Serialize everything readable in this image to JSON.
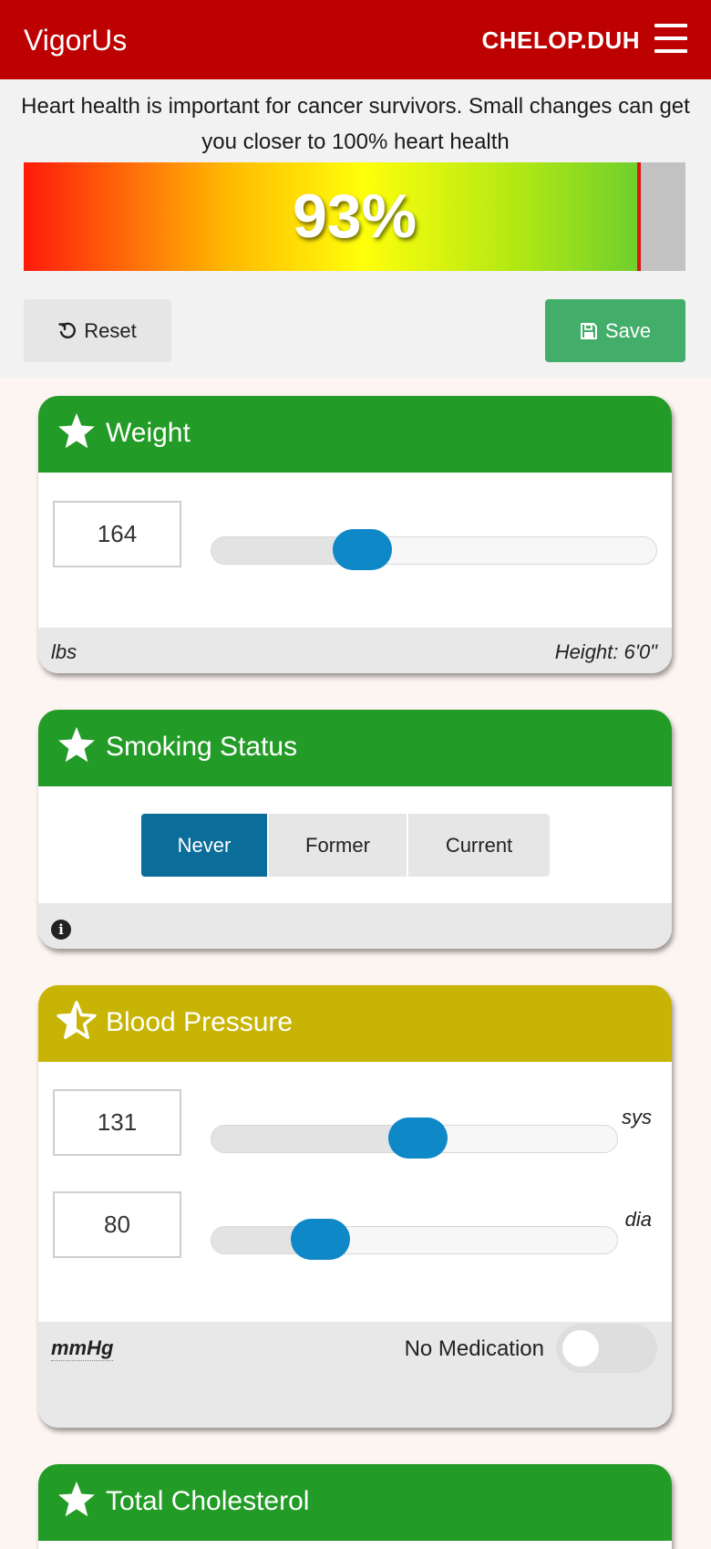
{
  "header": {
    "brand": "VigorUs",
    "username": "CHELOP.DUH",
    "menu_icon": "hamburger-menu-icon",
    "background_color": "#bd0000"
  },
  "summary": {
    "message": "Heart health is important for cancer survivors. Small changes can get you closer to 100% heart health",
    "score_label": "93%",
    "score_fraction": 0.93,
    "reset_label": "Reset",
    "reset_icon": "undo-icon",
    "save_label": "Save",
    "save_icon": "floppy-disk-icon"
  },
  "cards": {
    "weight": {
      "title": "Weight",
      "status_icon": "star-filled-icon",
      "header_color": "#239b27",
      "value": "164",
      "slider_fraction": 0.34,
      "unit": "lbs",
      "height_note": "Height: 6'0\""
    },
    "smoking": {
      "title": "Smoking Status",
      "status_icon": "star-filled-icon",
      "header_color": "#239b27",
      "options": [
        "Never",
        "Former",
        "Current"
      ],
      "selected": "Never",
      "info_icon": "info-circle-icon"
    },
    "blood_pressure": {
      "title": "Blood Pressure",
      "status_icon": "star-half-icon",
      "header_color": "#c8b404",
      "systolic": "131",
      "systolic_label": "sys",
      "systolic_fraction": 0.51,
      "diastolic": "80",
      "diastolic_label": "dia",
      "diastolic_fraction": 0.27,
      "unit": "mmHg",
      "medication_label": "No Medication",
      "medication_on": false
    },
    "cholesterol": {
      "title": "Total Cholesterol",
      "status_icon": "star-filled-icon",
      "header_color": "#239b27"
    }
  }
}
